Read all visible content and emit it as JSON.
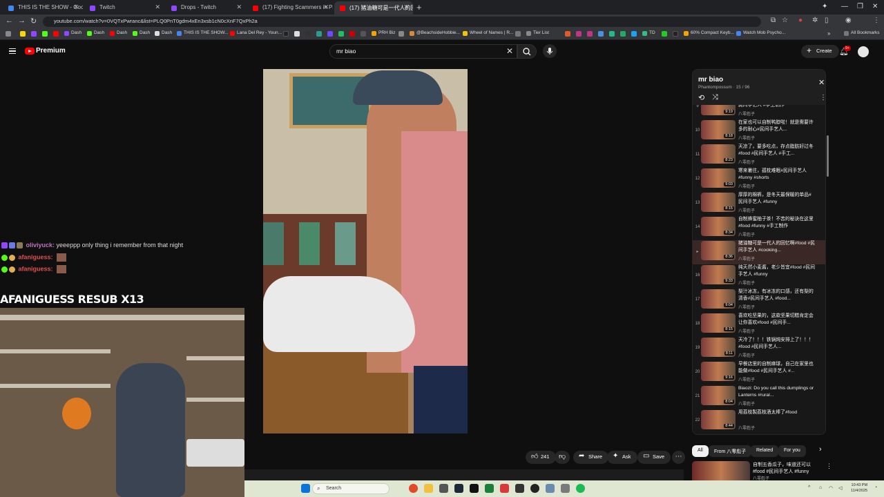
{
  "browser": {
    "tabs": [
      {
        "label": "THIS IS THE SHOW - Google D",
        "color": "#4285f4"
      },
      {
        "label": "Twitch",
        "color": "#9146ff"
      },
      {
        "label": "Drops - Twitch",
        "color": "#9146ff"
      },
      {
        "label": "(17) Fighting Scammers in Pari",
        "color": "#ff0000"
      },
      {
        "label": "(17) 猪油糖可是一代人的回",
        "color": "#ff0000",
        "active": true
      }
    ],
    "url": "youtube.com/watch?v=0VQTxPwranc&list=PLQ0PnT0gdm4xEn3xsb1cN0cXnF7QxPh2a",
    "bookmarks": [
      "Dash",
      "Dash",
      "Dash",
      "Dash",
      "Dash",
      "THIS IS THE SHOW...",
      "Lana Del Rey - Youn...",
      "PRH Biz",
      "@BeachsideHobbie...",
      "Wheel of Names | R...",
      "Tier List",
      "TD",
      "60% Compact Keyb...",
      "Watch Mob Psycho..."
    ],
    "all_bookmarks": "All Bookmarks"
  },
  "youtube": {
    "brand": "Premium",
    "search_value": "mr biao",
    "create_label": "Create",
    "notif_count": "9+"
  },
  "stream": {
    "chat": [
      {
        "user": "oliviyuck:",
        "msg": "yeeeppp only thing i remember from that night",
        "color": "#c070c0"
      },
      {
        "user": "afaniguess:",
        "msg": "",
        "color": "#e05050"
      },
      {
        "user": "afaniguess:",
        "msg": "",
        "color": "#e05050"
      }
    ],
    "alert": "AFANIGUESS RESUB X13"
  },
  "actions": {
    "likes": "241",
    "share": "Share",
    "ask": "Ask",
    "save": "Save"
  },
  "playlist": {
    "title": "mr biao",
    "subtitle": "Phantompossum · 15 / 96",
    "items": [
      {
        "idx": "9",
        "title": "嗓子不舒服，救命神器！！！#food #民间手艺人 #手工制作",
        "channel": "八零彪子",
        "duration": "9:19"
      },
      {
        "idx": "10",
        "title": "在家也可以自制鸭脖啦！就是需要许多的耐心#民间手艺人...",
        "channel": "八零彪子",
        "duration": "8:18"
      },
      {
        "idx": "11",
        "title": "天凉了，要多吃点，存点脂肪好过冬#food #民间手艺人 #手工...",
        "channel": "八零彪子",
        "duration": "8:23"
      },
      {
        "idx": "12",
        "title": "寒来暑往，孤枕难眠#民间手艺人 #funny #shorts",
        "channel": "八零彪子",
        "duration": "9:03"
      },
      {
        "idx": "13",
        "title": "厚厚的棉裤，是冬天最保暖的单品#民间手艺人 #funny",
        "channel": "八零彪子",
        "duration": "8:15"
      },
      {
        "idx": "14",
        "title": "自制蜂蜜柚子茶！不苦的秘诀在这里#food #funny #手工制作",
        "channel": "八零彪子",
        "duration": "8:34"
      },
      {
        "idx": "▸",
        "title": "猪油糖可是一代人的回忆啊#food #民间手艺人 #cooking...",
        "channel": "八零彪子",
        "duration": "8:36",
        "current": true
      },
      {
        "idx": "16",
        "title": "纯天然小麦酱，老少皆宜#food #民间手艺人 #funny",
        "channel": "八零彪子",
        "duration": "9:33"
      },
      {
        "idx": "17",
        "title": "梨汁冰冻，有冰冻的口感，还有梨的清香#民间手艺人 #food...",
        "channel": "八零彪子",
        "duration": "9:04"
      },
      {
        "idx": "18",
        "title": "喜欢吃坚果的，这款坚果切糕肯定会让你喜欢#food #民间手...",
        "channel": "八零彪子",
        "duration": "8:15"
      },
      {
        "idx": "19",
        "title": "天冷了！！！铁锅炖安排上了！！！#food #民间手艺人...",
        "channel": "八零彪子",
        "duration": "8:11"
      },
      {
        "idx": "20",
        "title": "早餐店里的自制麻球，自己在家里也能做#food #民间手艺人 #...",
        "channel": "八零彪子",
        "duration": "9:16"
      },
      {
        "idx": "21",
        "title": "Biaozi: Do you call this dumplings or Lanterns #rural...",
        "channel": "八零彪子",
        "duration": "8:04"
      },
      {
        "idx": "22",
        "title": "用荔枝製荔枝酒太棒了#food",
        "channel": "八零彪子",
        "duration": "8:44"
      }
    ]
  },
  "chips": [
    "All",
    "From 八零彪子",
    "Related",
    "For you"
  ],
  "recommendation": {
    "title": "自制五香瓜子，味道还可以#food #民间手艺人 #funny",
    "channel": "八零彪子"
  },
  "taskbar": {
    "search": "Search",
    "time": "10:43 PM",
    "date": "11/4/2025"
  }
}
